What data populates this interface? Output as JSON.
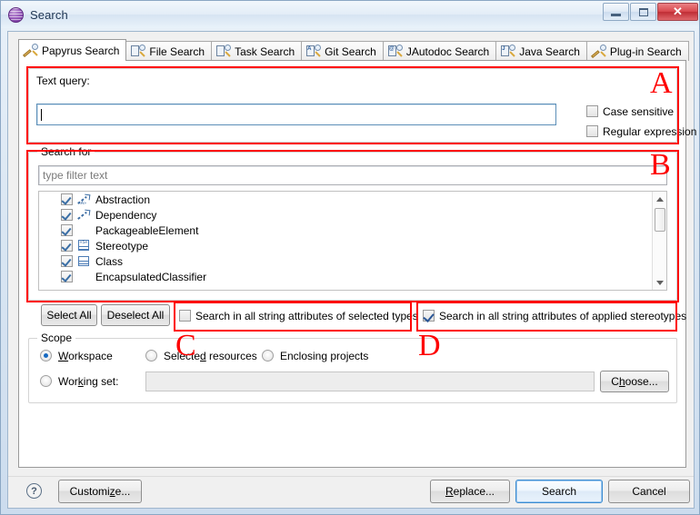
{
  "window": {
    "title": "Search",
    "icon": "papyrus-search-icon",
    "controls": {
      "minimize": "minimize-button",
      "maximize": "maximize-button",
      "close": "✕"
    }
  },
  "tabs": [
    {
      "label": "Papyrus Search",
      "icon": "papyrus-search-tab-icon",
      "active": true,
      "mark": ""
    },
    {
      "label": "File Search",
      "icon": "file-search-tab-icon",
      "active": false,
      "mark": ""
    },
    {
      "label": "Task Search",
      "icon": "task-search-tab-icon",
      "active": false,
      "mark": ""
    },
    {
      "label": "Git Search",
      "icon": "git-search-tab-icon",
      "active": false,
      "mark": "A"
    },
    {
      "label": "JAutodoc Search",
      "icon": "jautodoc-search-tab-icon",
      "active": false,
      "mark": "@"
    },
    {
      "label": "Java Search",
      "icon": "java-search-tab-icon",
      "active": false,
      "mark": "J"
    },
    {
      "label": "Plug-in Search",
      "icon": "plugin-search-tab-icon",
      "active": false,
      "mark": ""
    }
  ],
  "text_query": {
    "label": "Text query:",
    "value": "",
    "placeholder": "",
    "case_sensitive": {
      "label": "Case sensitive",
      "checked": false
    },
    "regular_expression": {
      "label": "Regular expression",
      "checked": false
    }
  },
  "search_for": {
    "legend": "Search for",
    "filter": {
      "value": "",
      "placeholder": "type filter text"
    },
    "items": [
      {
        "label": "Abstraction",
        "checked": true,
        "icon": "abstraction-icon"
      },
      {
        "label": "Dependency",
        "checked": true,
        "icon": "dependency-icon"
      },
      {
        "label": "PackageableElement",
        "checked": true,
        "icon": "none"
      },
      {
        "label": "Stereotype",
        "checked": true,
        "icon": "stereotype-icon"
      },
      {
        "label": "Class",
        "checked": true,
        "icon": "class-icon"
      },
      {
        "label": "EncapsulatedClassifier",
        "checked": true,
        "icon": "none"
      }
    ],
    "select_all": "Select All",
    "deselect_all": "Deselect All",
    "search_selected_types": {
      "label": "Search in all string attributes of selected types",
      "checked": false
    },
    "search_applied_stereotypes": {
      "label": "Search in all string attributes of applied stereotypes",
      "checked": true
    }
  },
  "scope": {
    "legend": "Scope",
    "options": [
      {
        "label": "Workspace",
        "mnemonic": "W",
        "selected": true
      },
      {
        "label": "Selected resources",
        "mnemonic": "d",
        "selected": false
      },
      {
        "label": "Enclosing projects",
        "mnemonic": "",
        "selected": false
      },
      {
        "label": "Working set:",
        "mnemonic": "k",
        "selected": false
      }
    ],
    "working_set_value": "",
    "choose_button": "Choose..."
  },
  "footer": {
    "help": "?",
    "customize": "Customize...",
    "replace": "Replace...",
    "search": "Search",
    "cancel": "Cancel"
  },
  "annotations": [
    {
      "letter": "A",
      "target": "text-query-group"
    },
    {
      "letter": "B",
      "target": "search-for-group"
    },
    {
      "letter": "C",
      "target": "search-selected-types-checkbox"
    },
    {
      "letter": "D",
      "target": "search-applied-stereotypes-checkbox"
    }
  ],
  "colors": {
    "annotation": "#fe0000",
    "accent": "#3c8bd0",
    "title_text": "#1d3552"
  }
}
